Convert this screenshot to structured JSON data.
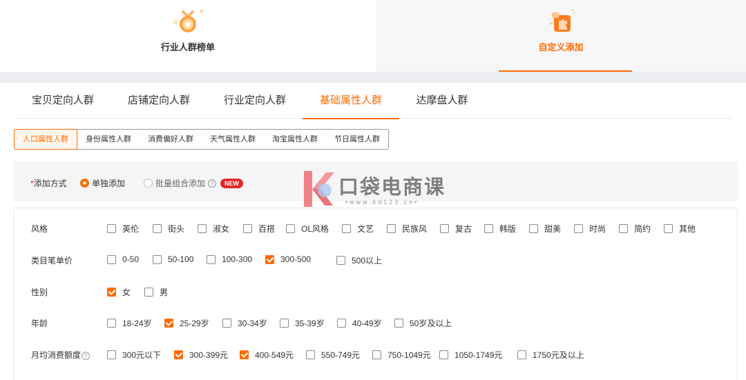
{
  "top_tabs": [
    {
      "label": "行业人群榜单",
      "icon": "medal-icon"
    },
    {
      "label": "自定义添加",
      "icon": "puzzle-icon"
    }
  ],
  "secondary_tabs": [
    "宝贝定向人群",
    "店铺定向人群",
    "行业定向人群",
    "基础属性人群",
    "达摩盘人群"
  ],
  "secondary_active": "基础属性人群",
  "pills": [
    "人口属性人群",
    "身份属性人群",
    "消费偏好人群",
    "天气属性人群",
    "淘宝属性人群",
    "节日属性人群"
  ],
  "pills_active": "人口属性人群",
  "mode": {
    "required_mark": "*",
    "label": "添加方式",
    "single": "单独添加",
    "batch": "批量组合添加",
    "help": "?",
    "new_badge": "NEW"
  },
  "watermark": {
    "text": "口袋电商课",
    "url": "•www.kd123.cn•",
    "logo_letter": "K"
  },
  "attributes": {
    "style": {
      "label": "风格",
      "options": [
        "英伦",
        "街头",
        "淑女",
        "百搭",
        "OL风格",
        "文艺",
        "民族风",
        "复古",
        "韩版",
        "甜美",
        "时尚",
        "简约",
        "其他"
      ],
      "checked": []
    },
    "price": {
      "label": "类目笔单价",
      "options": [
        "0-50",
        "50-100",
        "100-300",
        "300-500",
        "500以上"
      ],
      "checked": [
        "300-500"
      ]
    },
    "gender": {
      "label": "性别",
      "options": [
        "女",
        "男"
      ],
      "checked": [
        "女"
      ]
    },
    "age": {
      "label": "年龄",
      "options": [
        "18-24岁",
        "25-29岁",
        "30-34岁",
        "35-39岁",
        "40-49岁",
        "50岁及以上"
      ],
      "checked": [
        "25-29岁"
      ]
    },
    "spend": {
      "label": "月均消费额度",
      "help": "?",
      "options": [
        "300元以下",
        "300-399元",
        "400-549元",
        "550-749元",
        "750-1049元",
        "1050-1749元",
        "1750元及以上"
      ],
      "checked": [
        "300-399元",
        "400-549元"
      ]
    }
  },
  "colors": {
    "accent": "#ff6a00",
    "badge": "#e5262a",
    "watermark_logo": "#ee6d73"
  }
}
